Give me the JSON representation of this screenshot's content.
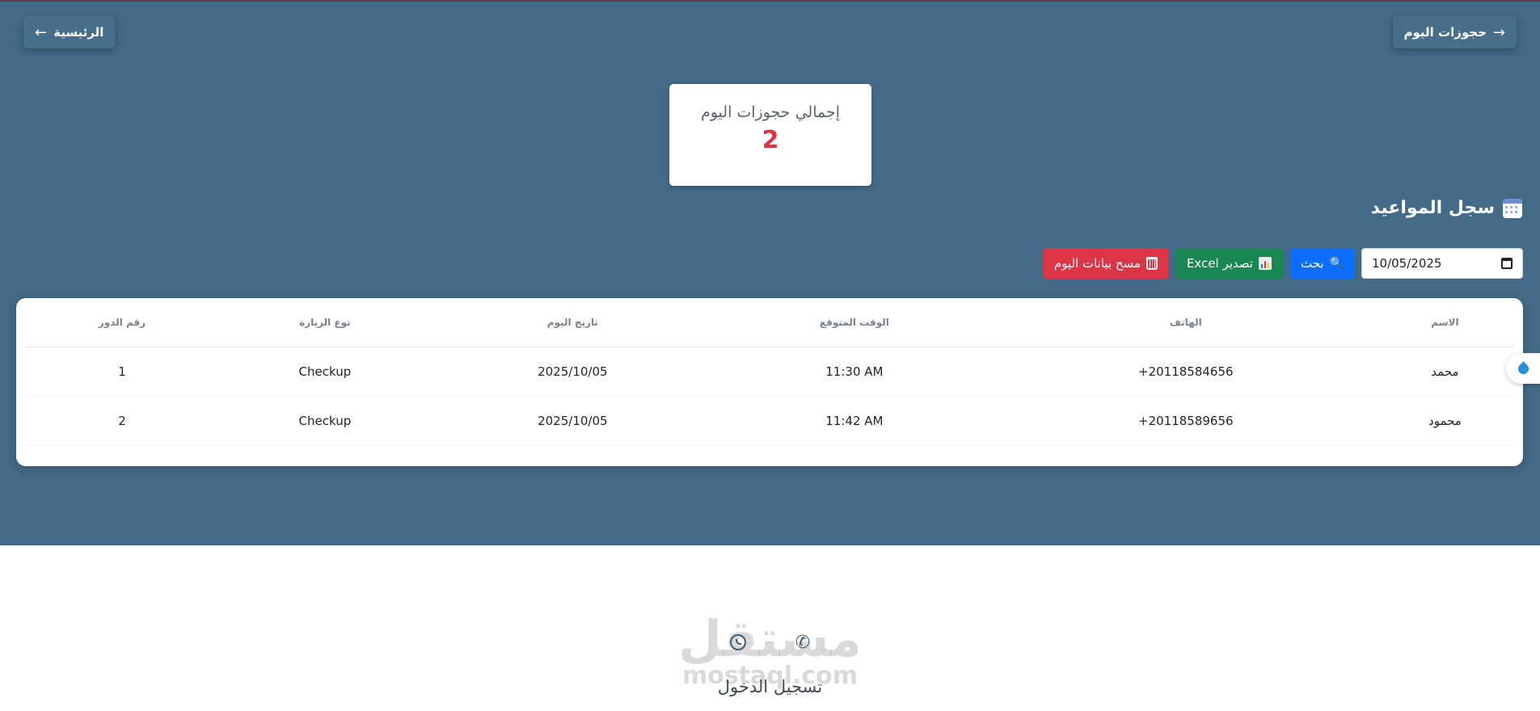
{
  "nav": {
    "today_label": "حجوزات اليوم",
    "today_arrow": "→",
    "home_label": "الرئيسية",
    "home_arrow": "←"
  },
  "summary": {
    "title": "إجمالي حجوزات اليوم",
    "count": "2"
  },
  "section": {
    "title": "سجل المواعيد",
    "icon": "calendar-icon"
  },
  "toolbar": {
    "date_value": "10/05/2025",
    "search_label": "بحث",
    "search_icon": "🔍",
    "excel_label": "تصدير Excel",
    "clear_label": "مسح بيانات اليوم"
  },
  "table": {
    "headers": [
      "الاسم",
      "الهاتف",
      "الوقت المتوقع",
      "تاريخ اليوم",
      "نوع الزيارة",
      "رقم الدور"
    ],
    "rows": [
      {
        "name": "محمد",
        "phone": "+20118584656",
        "time": "11:30 AM",
        "date": "2025/10/05",
        "visit_type": "Checkup",
        "queue": "1"
      },
      {
        "name": "محمود",
        "phone": "+20118589656",
        "time": "11:42 AM",
        "date": "2025/10/05",
        "visit_type": "Checkup",
        "queue": "2"
      }
    ]
  },
  "footer": {
    "watermark_ar": "مستقل",
    "watermark_en": "mostaql.com",
    "phone_icon": "✆",
    "login_label": "تسجيل الدخول"
  },
  "colors": {
    "hero_bg": "#436a87",
    "accent_red": "#dc3545",
    "search_blue": "#0d6efd",
    "excel_green": "#198754"
  }
}
